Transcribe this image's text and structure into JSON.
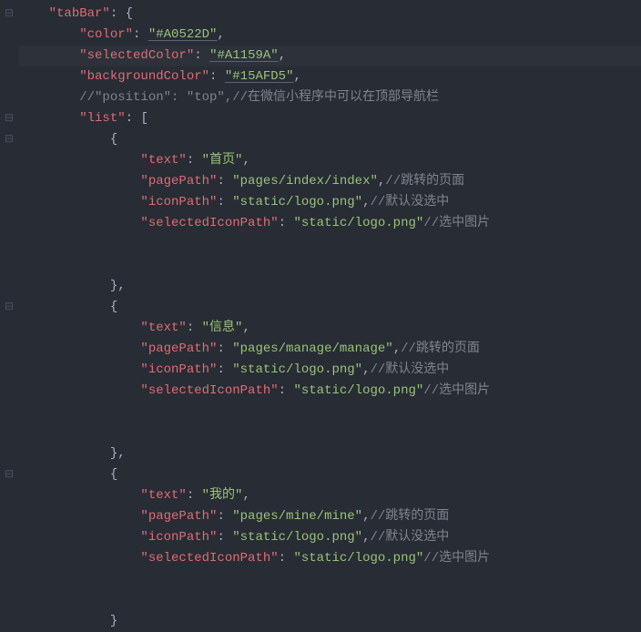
{
  "code": {
    "tabBar_key": "\"tabBar\"",
    "open_brace": ": {",
    "color_key": "\"color\"",
    "color_val": "\"#A0522D\"",
    "selectedColor_key": "\"selectedColor\"",
    "selectedColor_val": "\"#A1159A\"",
    "backgroundColor_key": "\"backgroundColor\"",
    "backgroundColor_val": "\"#15AFD5\"",
    "position_comment": "//\"position\": \"top\",//在微信小程序中可以在顶部导航栏",
    "list_key": "\"list\"",
    "list_open": ": [",
    "item_open": "{",
    "text_key": "\"text\"",
    "pagePath_key": "\"pagePath\"",
    "iconPath_key": "\"iconPath\"",
    "selectedIconPath_key": "\"selectedIconPath\"",
    "item1_text": "\"首页\"",
    "item1_pagePath": "\"pages/index/index\"",
    "logo_png": "\"static/logo.png\"",
    "item2_text": "\"信息\"",
    "item2_pagePath": "\"pages/manage/manage\"",
    "item3_text": "\"我的\"",
    "item3_pagePath": "\"pages/mine/mine\"",
    "comment_jump": "//跳转的页面",
    "comment_default_unselected": "//默认没选中",
    "comment_selected_img": "//选中图片",
    "item_close_comma": "},",
    "item_close": "}",
    "comma": ",",
    "colon_sp": ": "
  },
  "fold_icons": {
    "collapse": "⊟",
    "expand": "⊞",
    "none": ""
  }
}
